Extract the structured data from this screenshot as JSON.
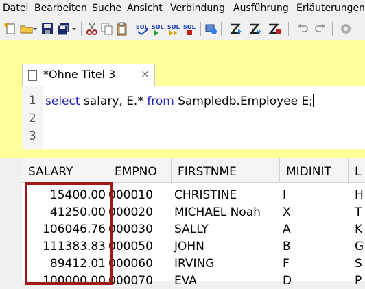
{
  "menu": [
    "Datei",
    "Bearbeiten",
    "Suche",
    "Ansicht",
    "Verbindung",
    "Ausführung",
    "Erläuterungen"
  ],
  "menu_mnemonics": [
    "D",
    "B",
    "S",
    "A",
    "V",
    "A",
    "E"
  ],
  "toolbar_icons": [
    "new-file-icon",
    "open-folder-icon",
    "save-icon",
    "save-all-icon",
    "dropdown-arrow-icon",
    "cut-icon",
    "copy-icon",
    "paste-icon",
    "sql-icon",
    "sql-run-icon",
    "sql-run-all-icon",
    "sql-stop-icon",
    "connect-icon",
    "explain-icon",
    "explain-all-icon",
    "explain-stop-icon",
    "undo-icon",
    "redo-icon",
    "settings-icon"
  ],
  "tab": {
    "title": "*Ohne Titel 3",
    "close": "×"
  },
  "editor": {
    "line_numbers": [
      "1",
      "2",
      "3"
    ],
    "tokens": [
      {
        "text": "select",
        "type": "keyword"
      },
      {
        "text": " salary, E.* ",
        "type": "plain"
      },
      {
        "text": "from",
        "type": "keyword"
      },
      {
        "text": " Sampledb.Employee E;",
        "type": "plain"
      }
    ]
  },
  "grid": {
    "columns": [
      "SALARY",
      "EMPNO",
      "FIRSTNME",
      "MIDINIT",
      "L"
    ],
    "rows": [
      [
        "15400.00",
        "000010",
        "CHRISTINE",
        "I",
        "H"
      ],
      [
        "41250.00",
        "000020",
        "MICHAEL Noah",
        "X",
        "T"
      ],
      [
        "106046.76",
        "000030",
        "SALLY",
        "A",
        "K"
      ],
      [
        "111383.83",
        "000050",
        "JOHN",
        "B",
        "G"
      ],
      [
        "89412.01",
        "000060",
        "IRVING",
        "F",
        "S"
      ],
      [
        "100000.00",
        "000070",
        "EVA",
        "D",
        "P"
      ]
    ]
  },
  "colors": {
    "editor_bg_highlight": "#ffff9c",
    "keyword": "#2020c0",
    "highlight_box": "#a01818"
  }
}
